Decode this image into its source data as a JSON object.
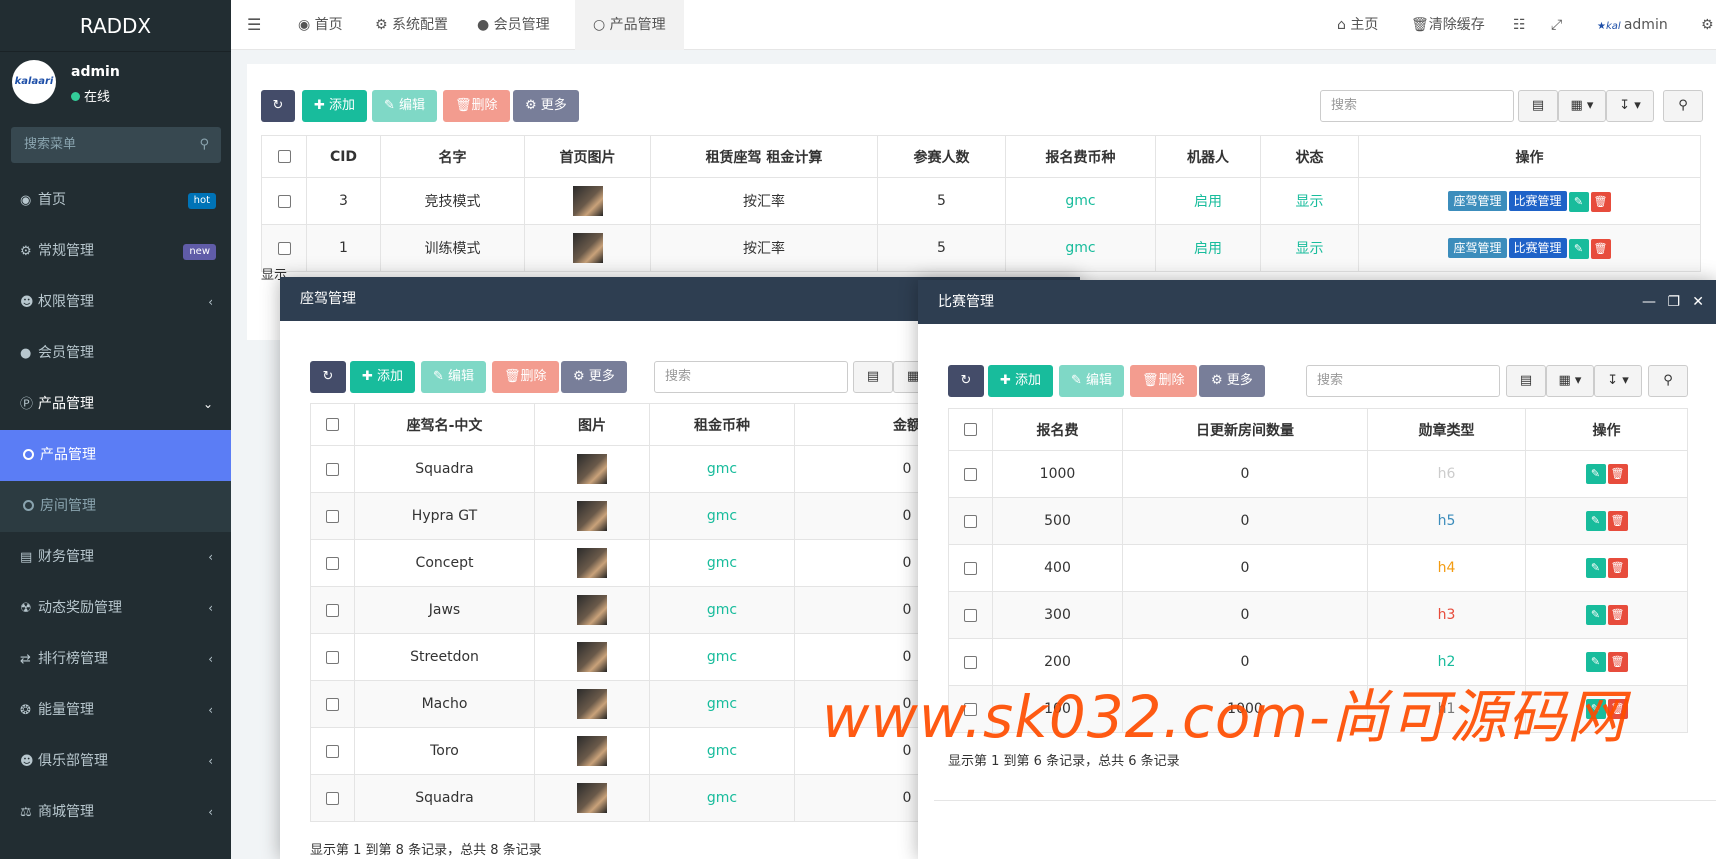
{
  "app": {
    "title": "RADDX"
  },
  "user": {
    "name": "admin",
    "status": "在线",
    "avatar_text": "kalaari"
  },
  "sidebar": {
    "search_placeholder": "搜索菜单",
    "items": [
      {
        "label": "首页",
        "icon": "dashboard-icon",
        "badge": "hot",
        "badge_color": "#0073b7"
      },
      {
        "label": "常规管理",
        "icon": "cogs-icon",
        "badge": "new",
        "badge_color": "#605ca8"
      },
      {
        "label": "权限管理",
        "icon": "users-icon"
      },
      {
        "label": "会员管理",
        "icon": "user-icon"
      },
      {
        "label": "产品管理",
        "icon": "product-icon",
        "open": true,
        "children": [
          {
            "label": "产品管理",
            "active": true
          },
          {
            "label": "房间管理"
          }
        ]
      },
      {
        "label": "财务管理",
        "icon": "credit-card-icon"
      },
      {
        "label": "动态奖励管理",
        "icon": "trophy-icon"
      },
      {
        "label": "排行榜管理",
        "icon": "random-icon"
      },
      {
        "label": "能量管理",
        "icon": "compass-icon"
      },
      {
        "label": "俱乐部管理",
        "icon": "users-icon"
      },
      {
        "label": "商城管理",
        "icon": "balance-icon"
      }
    ]
  },
  "topbar": {
    "tabs": [
      {
        "label": "首页"
      },
      {
        "label": "系统配置"
      },
      {
        "label": "会员管理"
      },
      {
        "label": "产品管理",
        "active": true
      }
    ],
    "right": {
      "home": "主页",
      "clear_cache": "清除缓存",
      "user": "admin"
    }
  },
  "toolbar": {
    "add": "添加",
    "edit": "编辑",
    "delete": "删除",
    "more": "更多",
    "search_placeholder": "搜索"
  },
  "main_table": {
    "headers": [
      "CID",
      "名字",
      "首页图片",
      "租赁座驾 租金计算",
      "参赛人数",
      "报名费币种",
      "机器人",
      "状态",
      "操作"
    ],
    "rows": [
      {
        "cid": "3",
        "name": "竞技模式",
        "calc": "按汇率",
        "players": "5",
        "currency": "gmc",
        "robot": "启用",
        "status": "显示"
      },
      {
        "cid": "1",
        "name": "训练模式",
        "calc": "按汇率",
        "players": "5",
        "currency": "gmc",
        "robot": "启用",
        "status": "显示"
      }
    ],
    "op_labels": {
      "car": "座驾管理",
      "match": "比赛管理"
    },
    "footer_partial": "显示"
  },
  "car_panel": {
    "title": "座驾管理",
    "headers": [
      "座驾名-中文",
      "图片",
      "租金币种",
      "金额"
    ],
    "rows": [
      {
        "name": "Squadra",
        "currency": "gmc",
        "amount": "0"
      },
      {
        "name": "Hypra GT",
        "currency": "gmc",
        "amount": "0"
      },
      {
        "name": "Concept",
        "currency": "gmc",
        "amount": "0"
      },
      {
        "name": "Jaws",
        "currency": "gmc",
        "amount": "0"
      },
      {
        "name": "Streetdon",
        "currency": "gmc",
        "amount": "0"
      },
      {
        "name": "Macho",
        "currency": "gmc",
        "amount": "0"
      },
      {
        "name": "Toro",
        "currency": "gmc",
        "amount": "0"
      },
      {
        "name": "Squadra",
        "currency": "gmc",
        "amount": "0"
      }
    ],
    "footer": "显示第 1 到第 8 条记录，总共 8 条记录"
  },
  "match_panel": {
    "title": "比赛管理",
    "headers": [
      "报名费",
      "日更新房间数量",
      "勋章类型",
      "操作"
    ],
    "rows": [
      {
        "fee": "1000",
        "rooms": "0",
        "medal": "h6",
        "medal_color": "#cccccc"
      },
      {
        "fee": "500",
        "rooms": "0",
        "medal": "h5",
        "medal_color": "#3c8dbc"
      },
      {
        "fee": "400",
        "rooms": "0",
        "medal": "h4",
        "medal_color": "#f39c12"
      },
      {
        "fee": "300",
        "rooms": "0",
        "medal": "h3",
        "medal_color": "#e74c3c"
      },
      {
        "fee": "200",
        "rooms": "0",
        "medal": "h2",
        "medal_color": "#18bc9c"
      },
      {
        "fee": "100",
        "rooms": "1000",
        "medal": "h1",
        "medal_color": "#777777"
      }
    ],
    "footer": "显示第 1 到第 6 条记录，总共 6 条记录"
  },
  "watermark": "www.sk032.com-尚可源码网"
}
